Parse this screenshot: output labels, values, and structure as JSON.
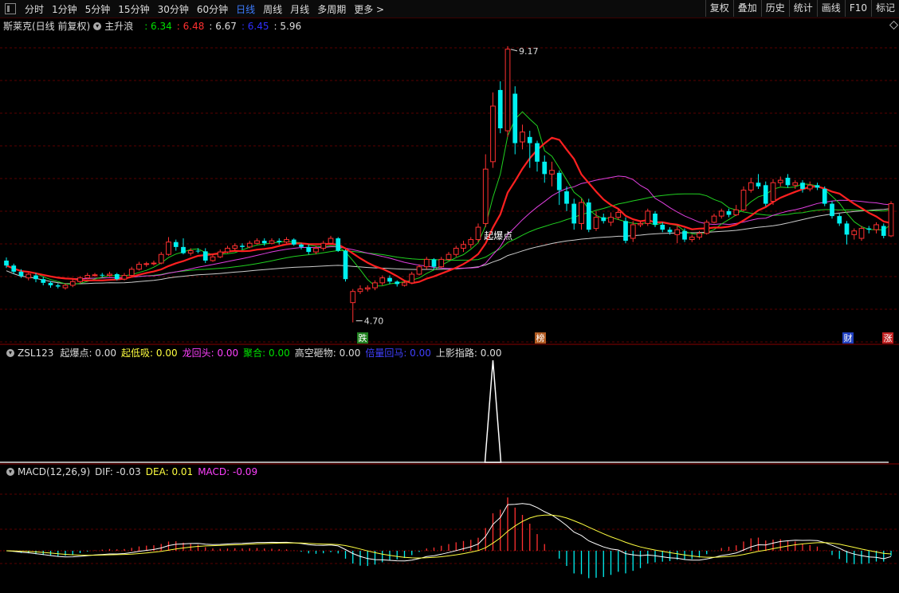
{
  "toolbar": {
    "periods": [
      "分时",
      "1分钟",
      "5分钟",
      "15分钟",
      "30分钟",
      "60分钟",
      "日线",
      "周线",
      "月线",
      "多周期",
      "更多 >"
    ],
    "active_period": "日线",
    "right_buttons": [
      "复权",
      "叠加",
      "历史",
      "统计",
      "画线",
      "F10",
      "标记"
    ]
  },
  "main_panel": {
    "stock_name": "斯莱克(日线 前复权)",
    "indicator_name": "主升浪",
    "ma_values": [
      {
        "value": ": 6.34",
        "color": "#00e000"
      },
      {
        "value": ": 6.48",
        "color": "#ff3030"
      },
      {
        "value": ": 6.67",
        "color": "#dddddd"
      },
      {
        "value": ": 6.45",
        "color": "#3030ff"
      },
      {
        "value": ": 5.96",
        "color": "#dddddd"
      }
    ],
    "high_label": "9.17",
    "low_label": "4.70",
    "signal_label": "起爆点",
    "badges": [
      {
        "text": "跌",
        "bg": "#208020"
      },
      {
        "text": "榜",
        "bg": "#b05a20"
      },
      {
        "text": "财",
        "bg": "#2040c0"
      },
      {
        "text": "涨",
        "bg": "#c02020"
      }
    ]
  },
  "zsl_panel": {
    "name": "ZSL123",
    "items": [
      {
        "label": "起爆点: 0.00",
        "color": "#dddddd"
      },
      {
        "label": "起低吸: 0.00",
        "color": "#ffff40"
      },
      {
        "label": "龙回头: 0.00",
        "color": "#ff40ff"
      },
      {
        "label": "聚合: 0.00",
        "color": "#00e000"
      },
      {
        "label": "高空砸物: 0.00",
        "color": "#dddddd"
      },
      {
        "label": "倍量回马: 0.00",
        "color": "#4040ff"
      },
      {
        "label": "上影指路: 0.00",
        "color": "#dddddd"
      }
    ]
  },
  "macd_panel": {
    "name": "MACD(12,26,9)",
    "dif": "DIF: -0.03",
    "dea": "DEA: 0.01",
    "macd": "MACD: -0.09"
  },
  "colors": {
    "up": "#ff3030",
    "down": "#00f0f0",
    "grid": "#5a0000",
    "ma_red": "#ff2020",
    "ma_green": "#20d020",
    "ma_magenta": "#e040e0",
    "ma_white": "#cccccc"
  },
  "chart_data": {
    "type": "candlestick",
    "price_range": [
      4.5,
      9.4
    ],
    "candles": [
      {
        "o": 5.7,
        "c": 5.62,
        "h": 5.75,
        "l": 5.58
      },
      {
        "o": 5.62,
        "c": 5.52,
        "h": 5.65,
        "l": 5.48
      },
      {
        "o": 5.52,
        "c": 5.45,
        "h": 5.56,
        "l": 5.42
      },
      {
        "o": 5.42,
        "c": 5.48,
        "h": 5.5,
        "l": 5.38
      },
      {
        "o": 5.46,
        "c": 5.4,
        "h": 5.5,
        "l": 5.35
      },
      {
        "o": 5.4,
        "c": 5.34,
        "h": 5.44,
        "l": 5.3
      },
      {
        "o": 5.34,
        "c": 5.3,
        "h": 5.37,
        "l": 5.26
      },
      {
        "o": 5.3,
        "c": 5.28,
        "h": 5.33,
        "l": 5.25
      },
      {
        "o": 5.26,
        "c": 5.3,
        "h": 5.33,
        "l": 5.23
      },
      {
        "o": 5.3,
        "c": 5.36,
        "h": 5.4,
        "l": 5.27
      },
      {
        "o": 5.36,
        "c": 5.42,
        "h": 5.45,
        "l": 5.33
      },
      {
        "o": 5.42,
        "c": 5.46,
        "h": 5.5,
        "l": 5.4
      },
      {
        "o": 5.46,
        "c": 5.47,
        "h": 5.5,
        "l": 5.44
      },
      {
        "o": 5.47,
        "c": 5.46,
        "h": 5.5,
        "l": 5.43
      },
      {
        "o": 5.46,
        "c": 5.48,
        "h": 5.52,
        "l": 5.44
      },
      {
        "o": 5.48,
        "c": 5.4,
        "h": 5.5,
        "l": 5.38
      },
      {
        "o": 5.4,
        "c": 5.46,
        "h": 5.5,
        "l": 5.38
      },
      {
        "o": 5.46,
        "c": 5.56,
        "h": 5.6,
        "l": 5.44
      },
      {
        "o": 5.56,
        "c": 5.64,
        "h": 5.68,
        "l": 5.54
      },
      {
        "o": 5.64,
        "c": 5.65,
        "h": 5.68,
        "l": 5.6
      },
      {
        "o": 5.65,
        "c": 5.66,
        "h": 5.7,
        "l": 5.62
      },
      {
        "o": 5.66,
        "c": 5.8,
        "h": 5.84,
        "l": 5.64
      },
      {
        "o": 5.8,
        "c": 6.0,
        "h": 6.08,
        "l": 5.78
      },
      {
        "o": 6.0,
        "c": 5.92,
        "h": 6.04,
        "l": 5.86
      },
      {
        "o": 5.92,
        "c": 5.82,
        "h": 6.06,
        "l": 5.8
      },
      {
        "o": 5.82,
        "c": 5.86,
        "h": 5.9,
        "l": 5.78
      },
      {
        "o": 5.86,
        "c": 5.85,
        "h": 5.9,
        "l": 5.82
      },
      {
        "o": 5.85,
        "c": 5.7,
        "h": 5.9,
        "l": 5.66
      },
      {
        "o": 5.7,
        "c": 5.76,
        "h": 5.8,
        "l": 5.68
      },
      {
        "o": 5.76,
        "c": 5.84,
        "h": 5.88,
        "l": 5.74
      },
      {
        "o": 5.84,
        "c": 5.9,
        "h": 5.94,
        "l": 5.82
      },
      {
        "o": 5.9,
        "c": 5.94,
        "h": 5.98,
        "l": 5.86
      },
      {
        "o": 5.94,
        "c": 5.92,
        "h": 5.98,
        "l": 5.88
      },
      {
        "o": 5.92,
        "c": 5.98,
        "h": 6.02,
        "l": 5.9
      },
      {
        "o": 5.98,
        "c": 6.02,
        "h": 6.06,
        "l": 5.96
      },
      {
        "o": 6.02,
        "c": 5.98,
        "h": 6.06,
        "l": 5.94
      },
      {
        "o": 5.98,
        "c": 6.02,
        "h": 6.06,
        "l": 5.96
      },
      {
        "o": 6.02,
        "c": 6.0,
        "h": 6.06,
        "l": 5.96
      },
      {
        "o": 6.0,
        "c": 6.04,
        "h": 6.08,
        "l": 5.98
      },
      {
        "o": 6.04,
        "c": 5.96,
        "h": 6.06,
        "l": 5.94
      },
      {
        "o": 5.96,
        "c": 5.92,
        "h": 5.98,
        "l": 5.88
      },
      {
        "o": 5.92,
        "c": 5.84,
        "h": 5.96,
        "l": 5.8
      },
      {
        "o": 5.84,
        "c": 5.9,
        "h": 5.94,
        "l": 5.8
      },
      {
        "o": 5.9,
        "c": 5.98,
        "h": 6.02,
        "l": 5.86
      },
      {
        "o": 5.98,
        "c": 6.06,
        "h": 6.1,
        "l": 5.96
      },
      {
        "o": 6.06,
        "c": 5.86,
        "h": 6.08,
        "l": 5.84
      },
      {
        "o": 5.86,
        "c": 5.4,
        "h": 5.88,
        "l": 5.36
      },
      {
        "o": 5.02,
        "c": 5.2,
        "h": 5.24,
        "l": 4.7
      },
      {
        "o": 5.2,
        "c": 5.24,
        "h": 5.3,
        "l": 5.16
      },
      {
        "o": 5.24,
        "c": 5.26,
        "h": 5.3,
        "l": 5.2
      },
      {
        "o": 5.26,
        "c": 5.34,
        "h": 5.38,
        "l": 5.22
      },
      {
        "o": 5.34,
        "c": 5.42,
        "h": 5.46,
        "l": 5.3
      },
      {
        "o": 5.42,
        "c": 5.36,
        "h": 5.46,
        "l": 5.32
      },
      {
        "o": 5.36,
        "c": 5.32,
        "h": 5.38,
        "l": 5.28
      },
      {
        "o": 5.3,
        "c": 5.34,
        "h": 5.38,
        "l": 5.28
      },
      {
        "o": 5.34,
        "c": 5.48,
        "h": 5.52,
        "l": 5.32
      },
      {
        "o": 5.48,
        "c": 5.6,
        "h": 5.64,
        "l": 5.46
      },
      {
        "o": 5.6,
        "c": 5.72,
        "h": 5.76,
        "l": 5.56
      },
      {
        "o": 5.72,
        "c": 5.6,
        "h": 5.74,
        "l": 5.56
      },
      {
        "o": 5.6,
        "c": 5.72,
        "h": 5.76,
        "l": 5.58
      },
      {
        "o": 5.72,
        "c": 5.8,
        "h": 5.84,
        "l": 5.7
      },
      {
        "o": 5.8,
        "c": 5.9,
        "h": 5.94,
        "l": 5.76
      },
      {
        "o": 5.9,
        "c": 5.96,
        "h": 6.02,
        "l": 5.84
      },
      {
        "o": 5.96,
        "c": 6.04,
        "h": 6.08,
        "l": 5.9
      },
      {
        "o": 6.04,
        "c": 6.24,
        "h": 6.3,
        "l": 6.0
      },
      {
        "o": 6.3,
        "c": 7.18,
        "h": 7.42,
        "l": 6.24
      },
      {
        "o": 7.3,
        "c": 8.2,
        "h": 8.42,
        "l": 7.2
      },
      {
        "o": 8.46,
        "c": 7.84,
        "h": 8.6,
        "l": 7.76
      },
      {
        "o": 7.8,
        "c": 9.12,
        "h": 9.17,
        "l": 7.7
      },
      {
        "o": 8.4,
        "c": 7.6,
        "h": 8.52,
        "l": 7.42
      },
      {
        "o": 7.62,
        "c": 7.78,
        "h": 7.9,
        "l": 7.5
      },
      {
        "o": 7.7,
        "c": 7.6,
        "h": 7.8,
        "l": 7.2
      },
      {
        "o": 7.6,
        "c": 7.3,
        "h": 7.64,
        "l": 7.14
      },
      {
        "o": 7.3,
        "c": 7.1,
        "h": 7.4,
        "l": 6.96
      },
      {
        "o": 7.1,
        "c": 7.16,
        "h": 7.3,
        "l": 6.9
      },
      {
        "o": 7.12,
        "c": 6.84,
        "h": 7.16,
        "l": 6.6
      },
      {
        "o": 6.82,
        "c": 6.62,
        "h": 6.9,
        "l": 6.5
      },
      {
        "o": 6.62,
        "c": 6.3,
        "h": 6.7,
        "l": 6.2
      },
      {
        "o": 6.3,
        "c": 6.64,
        "h": 6.7,
        "l": 6.2
      },
      {
        "o": 6.64,
        "c": 6.2,
        "h": 6.7,
        "l": 6.16
      },
      {
        "o": 6.22,
        "c": 6.4,
        "h": 6.5,
        "l": 6.18
      },
      {
        "o": 6.4,
        "c": 6.34,
        "h": 6.46,
        "l": 6.3
      },
      {
        "o": 6.32,
        "c": 6.4,
        "h": 6.48,
        "l": 6.26
      },
      {
        "o": 6.4,
        "c": 6.48,
        "h": 6.54,
        "l": 6.36
      },
      {
        "o": 6.34,
        "c": 6.02,
        "h": 6.4,
        "l": 5.98
      },
      {
        "o": 6.06,
        "c": 6.28,
        "h": 6.34,
        "l": 6.0
      },
      {
        "o": 6.28,
        "c": 6.3,
        "h": 6.34,
        "l": 6.24
      },
      {
        "o": 6.3,
        "c": 6.5,
        "h": 6.54,
        "l": 6.26
      },
      {
        "o": 6.46,
        "c": 6.28,
        "h": 6.5,
        "l": 6.24
      },
      {
        "o": 6.28,
        "c": 6.2,
        "h": 6.32,
        "l": 6.16
      },
      {
        "o": 6.2,
        "c": 6.16,
        "h": 6.24,
        "l": 6.12
      },
      {
        "o": 6.12,
        "c": 6.2,
        "h": 6.26,
        "l": 5.98
      },
      {
        "o": 6.18,
        "c": 6.04,
        "h": 6.22,
        "l": 6.0
      },
      {
        "o": 6.04,
        "c": 6.08,
        "h": 6.12,
        "l": 6.0
      },
      {
        "o": 6.08,
        "c": 6.14,
        "h": 6.18,
        "l": 6.04
      },
      {
        "o": 6.14,
        "c": 6.32,
        "h": 6.36,
        "l": 6.12
      },
      {
        "o": 6.32,
        "c": 6.42,
        "h": 6.46,
        "l": 6.3
      },
      {
        "o": 6.42,
        "c": 6.5,
        "h": 6.54,
        "l": 6.38
      },
      {
        "o": 6.5,
        "c": 6.44,
        "h": 6.54,
        "l": 6.4
      },
      {
        "o": 6.44,
        "c": 6.52,
        "h": 6.6,
        "l": 6.42
      },
      {
        "o": 6.52,
        "c": 6.84,
        "h": 6.9,
        "l": 6.5
      },
      {
        "o": 6.84,
        "c": 6.96,
        "h": 7.04,
        "l": 6.8
      },
      {
        "o": 6.96,
        "c": 6.9,
        "h": 7.1,
        "l": 6.86
      },
      {
        "o": 6.92,
        "c": 6.62,
        "h": 6.98,
        "l": 6.58
      },
      {
        "o": 6.66,
        "c": 6.96,
        "h": 7.02,
        "l": 6.6
      },
      {
        "o": 6.96,
        "c": 7.0,
        "h": 7.06,
        "l": 6.9
      },
      {
        "o": 7.04,
        "c": 6.92,
        "h": 7.1,
        "l": 6.88
      },
      {
        "o": 6.92,
        "c": 6.96,
        "h": 7.0,
        "l": 6.86
      },
      {
        "o": 6.96,
        "c": 6.86,
        "h": 7.0,
        "l": 6.8
      },
      {
        "o": 6.86,
        "c": 6.92,
        "h": 6.98,
        "l": 6.82
      },
      {
        "o": 6.92,
        "c": 6.88,
        "h": 6.96,
        "l": 6.84
      },
      {
        "o": 6.86,
        "c": 6.62,
        "h": 6.9,
        "l": 6.58
      },
      {
        "o": 6.62,
        "c": 6.42,
        "h": 6.66,
        "l": 6.38
      },
      {
        "o": 6.42,
        "c": 6.3,
        "h": 6.46,
        "l": 6.26
      },
      {
        "o": 6.3,
        "c": 6.12,
        "h": 6.34,
        "l": 5.96
      },
      {
        "o": 6.12,
        "c": 6.18,
        "h": 6.22,
        "l": 6.04
      },
      {
        "o": 6.06,
        "c": 6.22,
        "h": 6.26,
        "l": 6.02
      },
      {
        "o": 6.22,
        "c": 6.2,
        "h": 6.26,
        "l": 6.14
      },
      {
        "o": 6.2,
        "c": 6.28,
        "h": 6.32,
        "l": 6.14
      },
      {
        "o": 6.26,
        "c": 6.1,
        "h": 6.3,
        "l": 6.06
      },
      {
        "o": 6.1,
        "c": 6.62,
        "h": 6.66,
        "l": 6.08
      }
    ]
  }
}
